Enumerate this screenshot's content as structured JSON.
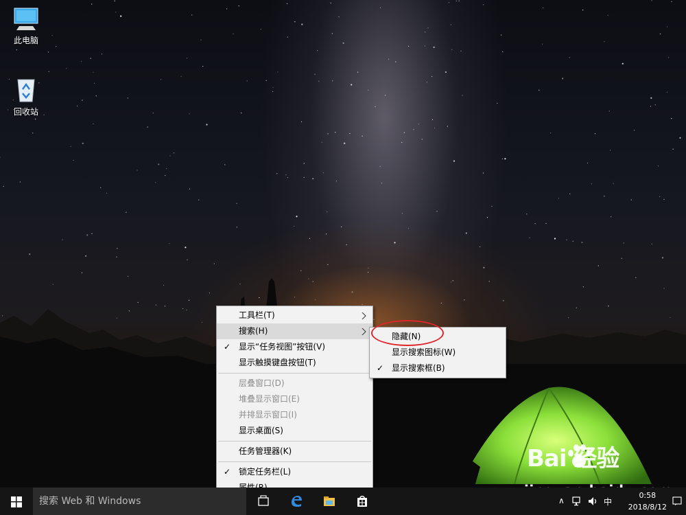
{
  "desktop": {
    "icons": [
      {
        "label": "此电脑",
        "icon": "this-pc-icon"
      },
      {
        "label": "回收站",
        "icon": "recycle-bin-icon"
      }
    ]
  },
  "context_menu": {
    "items": [
      {
        "label": "工具栏(T)",
        "has_submenu": true
      },
      {
        "label": "搜索(H)",
        "has_submenu": true,
        "highlighted": true
      },
      {
        "label": "显示“任务视图”按钮(V)",
        "checked": true
      },
      {
        "label": "显示触摸键盘按钮(T)"
      },
      {
        "label": "层叠窗口(D)",
        "disabled": true
      },
      {
        "label": "堆叠显示窗口(E)",
        "disabled": true
      },
      {
        "label": "并排显示窗口(I)",
        "disabled": true
      },
      {
        "label": "显示桌面(S)"
      },
      {
        "label": "任务管理器(K)"
      },
      {
        "label": "锁定任务栏(L)",
        "checked": true
      },
      {
        "label": "属性(R)"
      }
    ]
  },
  "search_submenu": {
    "items": [
      {
        "label": "隐藏(N)"
      },
      {
        "label": "显示搜索图标(W)"
      },
      {
        "label": "显示搜索框(B)",
        "checked": true
      }
    ],
    "check_mark": "✓"
  },
  "taskbar": {
    "search_placeholder": "搜索 Web 和 Windows",
    "tray": {
      "chevron": "∧",
      "ime": "中"
    },
    "clock": {
      "time": "0:58",
      "date": "2018/8/12"
    }
  },
  "watermark": {
    "brand": "Bai  经验",
    "url": "jingyan.baidu.com"
  },
  "colors": {
    "annotation_ring": "#e0262a",
    "tent_green": "#8be03a",
    "taskbar": "#151515"
  }
}
